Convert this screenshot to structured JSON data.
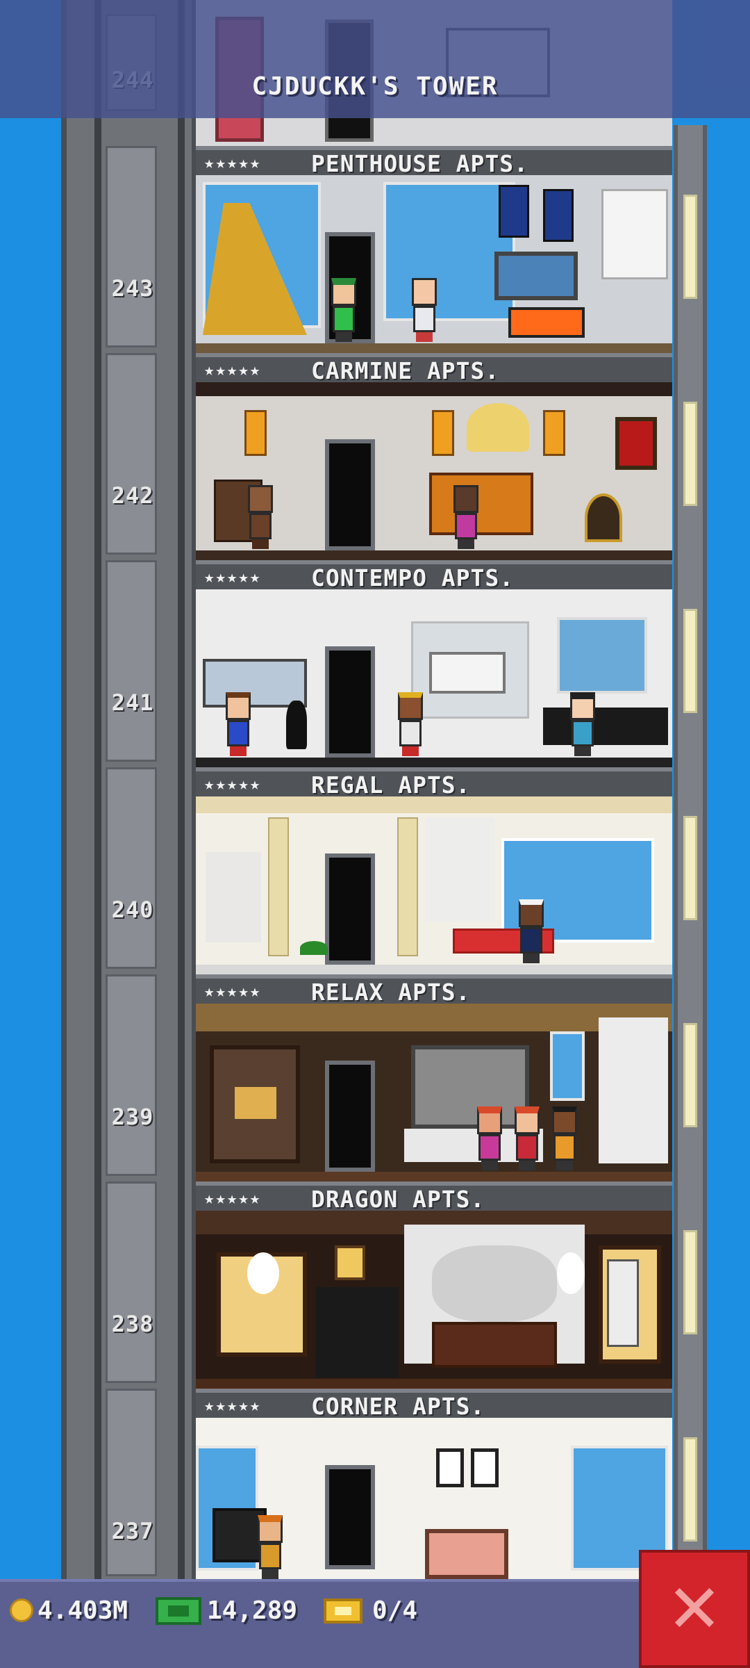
{
  "header": {
    "tower_title": "CJDUCKK'S TOWER",
    "top_floor_number": "244"
  },
  "floors": [
    {
      "number": "243",
      "name": "PENTHOUSE APTS.",
      "stars": "★★★★★"
    },
    {
      "number": "242",
      "name": "CARMINE APTS.",
      "stars": "★★★★★"
    },
    {
      "number": "241",
      "name": "CONTEMPO APTS.",
      "stars": "★★★★★"
    },
    {
      "number": "240",
      "name": "REGAL APTS.",
      "stars": "★★★★★"
    },
    {
      "number": "239",
      "name": "RELAX APTS.",
      "stars": "★★★★★"
    },
    {
      "number": "238",
      "name": "DRAGON APTS.",
      "stars": "★★★★★"
    },
    {
      "number": "237",
      "name": "CORNER APTS.",
      "stars": "★★★★★"
    }
  ],
  "status_bar": {
    "coins": "4.403M",
    "bux": "14,289",
    "tickets": "0/4"
  },
  "colors": {
    "sky": "#1d8fe2",
    "header": "#46508c",
    "bottom_bar": "#5c6090",
    "close_button": "#d3242b",
    "coin": "#f2c23a",
    "bux": "#36b04a",
    "ticket": "#f0c030"
  },
  "icons": [
    "coin-icon",
    "bux-icon",
    "ticket-icon",
    "close-icon"
  ]
}
